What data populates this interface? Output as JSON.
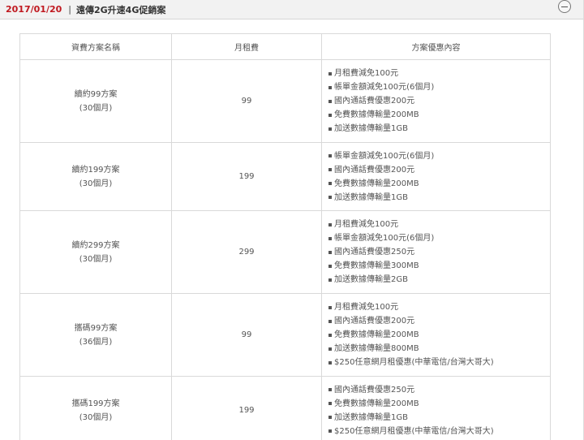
{
  "header": {
    "date": "2017/01/20",
    "separator": "|",
    "title": "遠傳2G升速4G促銷案"
  },
  "table": {
    "columns": [
      "資費方案名稱",
      "月租費",
      "方案優惠內容"
    ],
    "rows": [
      {
        "name": "續約99方案",
        "term": "(30個月)",
        "fee": "99",
        "features": [
          "月租費減免100元",
          "帳單金額減免100元(6個月)",
          "國內通話費優惠200元",
          "免費數據傳輸量200MB",
          "加送數據傳輸量1GB"
        ]
      },
      {
        "name": "續約199方案",
        "term": "(30個月)",
        "fee": "199",
        "features": [
          "帳單金額減免100元(6個月)",
          "國內通話費優惠200元",
          "免費數據傳輸量200MB",
          "加送數據傳輸量1GB"
        ]
      },
      {
        "name": "續約299方案",
        "term": "(30個月)",
        "fee": "299",
        "features": [
          "月租費減免100元",
          "帳單金額減免100元(6個月)",
          "國內通話費優惠250元",
          "免費數據傳輸量300MB",
          "加送數據傳輸量2GB"
        ]
      },
      {
        "name": "攜碼99方案",
        "term": "(36個月)",
        "fee": "99",
        "features": [
          "月租費減免100元",
          "國內通話費優惠200元",
          "免費數據傳輸量200MB",
          "加送數據傳輸量800MB",
          "$250任意網月租優惠(中華電信/台灣大哥大)"
        ]
      },
      {
        "name": "攜碼199方案",
        "term": "(30個月)",
        "fee": "199",
        "features": [
          "國內通話費優惠250元",
          "免費數據傳輸量200MB",
          "加送數據傳輸量1GB",
          "$250任意網月租優惠(中華電信/台灣大哥大)"
        ]
      }
    ]
  },
  "colors": {
    "date": "#c01920",
    "border": "#d9d9d9",
    "header_bg": "#f2f2f2"
  },
  "icons": {
    "collapse": "minus-circle-icon"
  }
}
